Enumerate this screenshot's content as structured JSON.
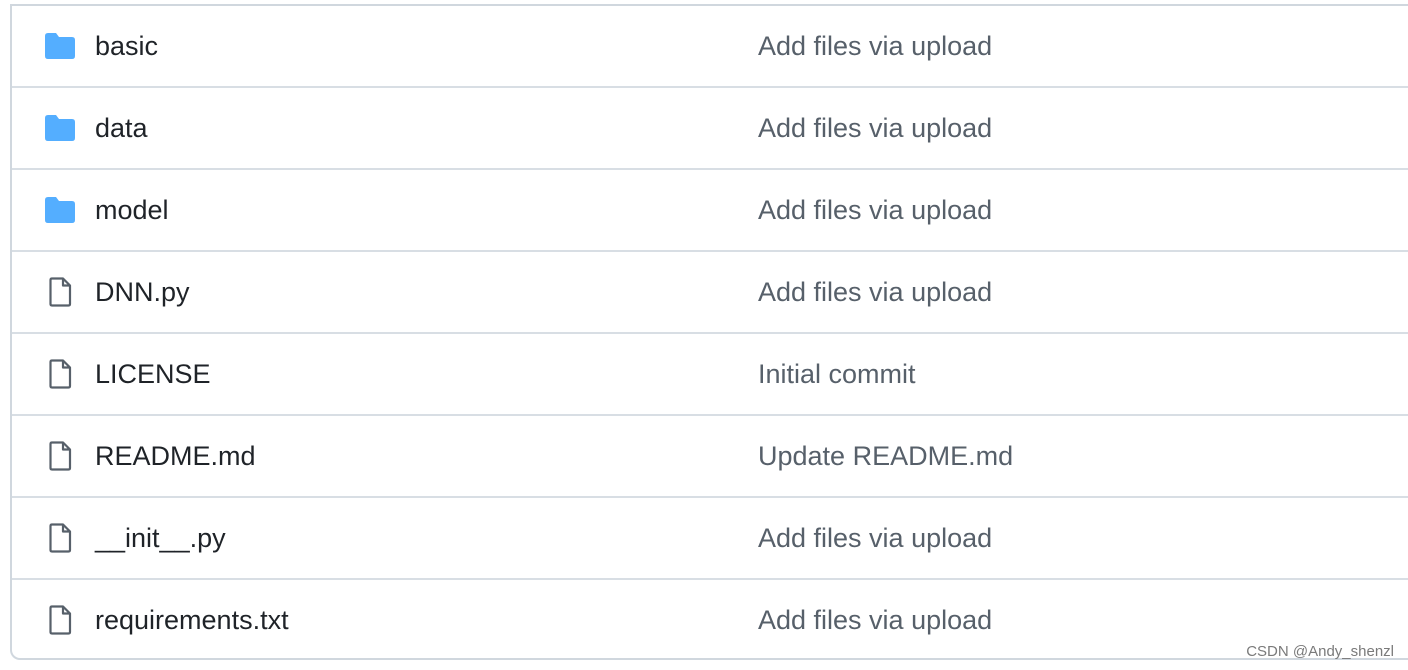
{
  "files": [
    {
      "name": "basic",
      "type": "folder",
      "icon": "folder-icon",
      "message": "Add files via upload"
    },
    {
      "name": "data",
      "type": "folder",
      "icon": "folder-icon",
      "message": "Add files via upload"
    },
    {
      "name": "model",
      "type": "folder",
      "icon": "folder-icon",
      "message": "Add files via upload"
    },
    {
      "name": "DNN.py",
      "type": "file",
      "icon": "file-icon",
      "message": "Add files via upload"
    },
    {
      "name": "LICENSE",
      "type": "file",
      "icon": "file-icon",
      "message": "Initial commit"
    },
    {
      "name": "README.md",
      "type": "file",
      "icon": "file-icon",
      "message": "Update README.md"
    },
    {
      "name": "__init__.py",
      "type": "file",
      "icon": "file-icon",
      "message": "Add files via upload"
    },
    {
      "name": "requirements.txt",
      "type": "file",
      "icon": "file-icon",
      "message": "Add files via upload"
    }
  ],
  "colors": {
    "folder": "#54aeff",
    "file_icon": "#57606a",
    "name_text": "#1f2328",
    "message_text": "#57606a",
    "divider": "#d8dee4"
  },
  "watermark": "CSDN @Andy_shenzl"
}
